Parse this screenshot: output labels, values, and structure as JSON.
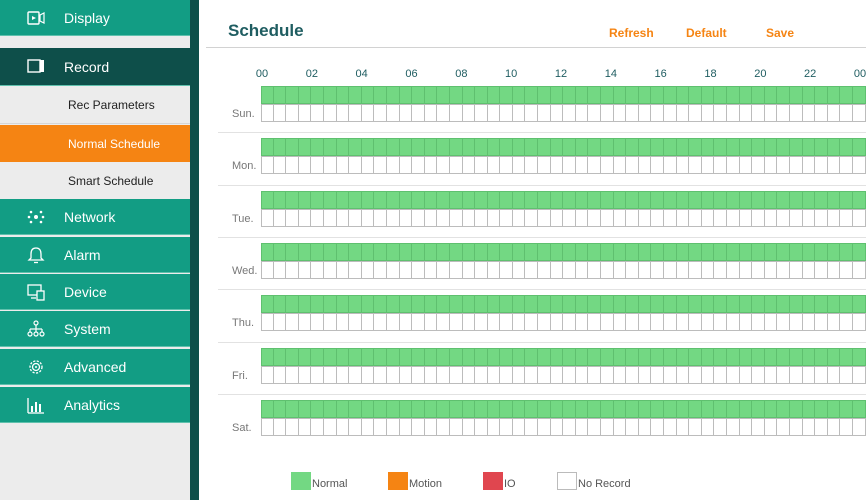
{
  "colors": {
    "accent_teal": "#129d84",
    "dark_teal": "#0e4f4a",
    "active_orange": "#f58413",
    "normal_green": "#73d883",
    "motion_orange": "#f58413",
    "io_red": "#e0464f",
    "no_record_white": "#ffffff"
  },
  "sidebar": {
    "items": [
      {
        "label": "Display",
        "icon": "display-icon"
      },
      {
        "label": "Record",
        "icon": "record-icon"
      },
      {
        "label": "Network",
        "icon": "network-icon"
      },
      {
        "label": "Alarm",
        "icon": "bell-icon"
      },
      {
        "label": "Device",
        "icon": "device-icon"
      },
      {
        "label": "System",
        "icon": "system-icon"
      },
      {
        "label": "Advanced",
        "icon": "gear-icon"
      },
      {
        "label": "Analytics",
        "icon": "analytics-icon"
      }
    ],
    "record_sub_items": [
      {
        "label": "Rec Parameters"
      },
      {
        "label": "Normal Schedule"
      },
      {
        "label": "Smart Schedule"
      }
    ]
  },
  "header": {
    "title": "Schedule",
    "refresh_label": "Refresh",
    "default_label": "Default",
    "save_label": "Save"
  },
  "schedule": {
    "hour_labels": [
      "00",
      "02",
      "04",
      "06",
      "08",
      "10",
      "12",
      "14",
      "16",
      "18",
      "20",
      "22",
      "00"
    ],
    "days": [
      {
        "label": "Sun.",
        "normal_hours": "00-24",
        "motion_hours": "none"
      },
      {
        "label": "Mon.",
        "normal_hours": "00-24",
        "motion_hours": "none"
      },
      {
        "label": "Tue.",
        "normal_hours": "00-24",
        "motion_hours": "none"
      },
      {
        "label": "Wed.",
        "normal_hours": "00-24",
        "motion_hours": "none"
      },
      {
        "label": "Thu.",
        "normal_hours": "00-24",
        "motion_hours": "none"
      },
      {
        "label": "Fri.",
        "normal_hours": "00-24",
        "motion_hours": "none"
      },
      {
        "label": "Sat.",
        "normal_hours": "00-24",
        "motion_hours": "none"
      }
    ]
  },
  "legend": [
    {
      "label": "Normal",
      "color": "#73d883"
    },
    {
      "label": "Motion",
      "color": "#f58413"
    },
    {
      "label": "IO",
      "color": "#e0464f"
    },
    {
      "label": "No Record",
      "color": "#ffffff"
    }
  ]
}
